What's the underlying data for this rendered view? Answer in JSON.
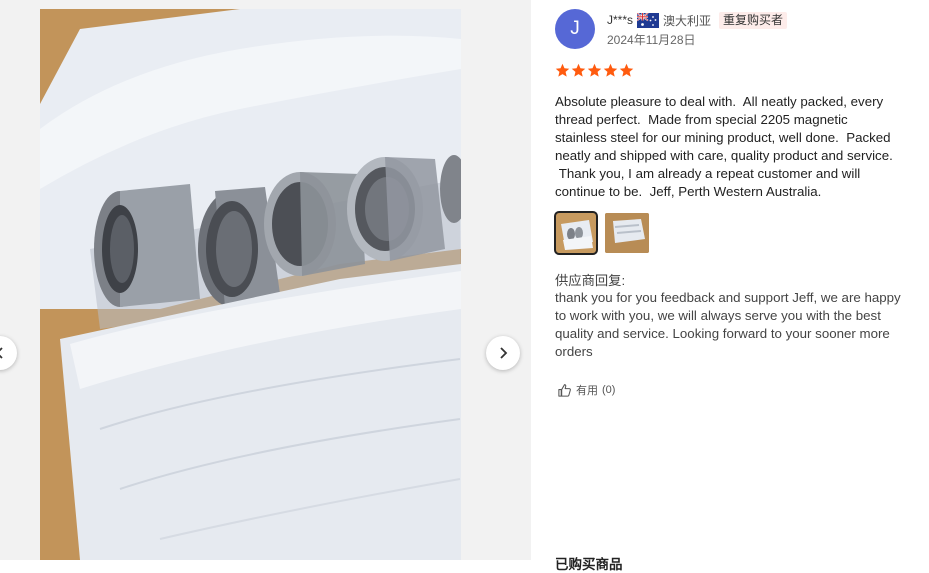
{
  "gallery": {
    "prev_icon": "chevron-left-icon",
    "next_icon": "chevron-right-icon",
    "colors": {
      "cardboard": "#c79a5f",
      "paper": "#e8ecf2",
      "steel": "#8a8e94"
    }
  },
  "review": {
    "avatar_letter": "J",
    "avatar_color": "#5668d6",
    "user_name": "J***s",
    "country": "澳大利亚",
    "badge": "重复购买者",
    "date": "2024年11月28日",
    "rating": 5,
    "rating_max": 5,
    "star_color": "#ff5b0f",
    "text": "Absolute pleasure to deal with.  All neatly packed, every\nthread perfect.  Made from special 2205 magnetic\nstainless steel for our mining product, well done.  Packed\nneatly and shipped with care, quality product and service.\n Thank you, I am already a repeat customer and will\ncontinue to be.  Jeff, Perth Western Australia.",
    "thumbnails": 2,
    "active_thumbnail": 1,
    "reply_label": "供应商回复:",
    "reply_text": "thank you for you feedback and support Jeff, we are happy\nto work with you, we will always serve you with the best\nquality and service. Looking forward to your sooner more\norders",
    "helpful_label": "有用",
    "helpful_count": "(0)"
  },
  "bottom": {
    "heading": "已购买商品"
  }
}
